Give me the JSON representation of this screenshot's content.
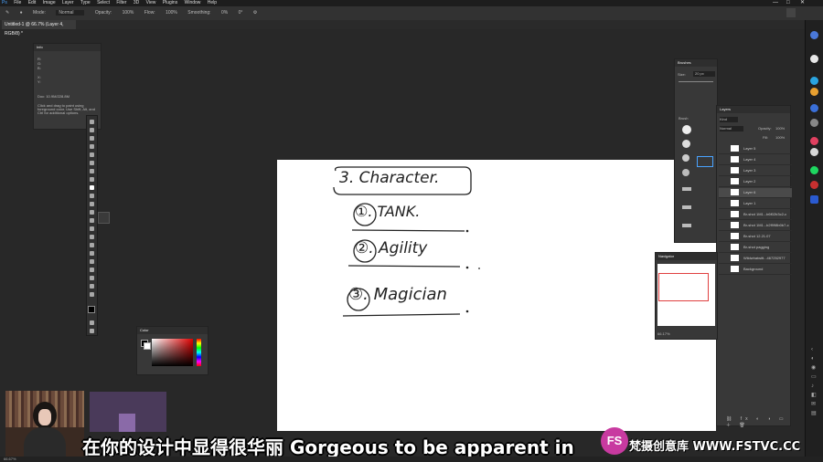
{
  "menu": {
    "items": [
      "File",
      "Edit",
      "Image",
      "Layer",
      "Type",
      "Select",
      "Filter",
      "3D",
      "View",
      "Plugins",
      "Window",
      "Help"
    ]
  },
  "options": {
    "mode_label": "Mode:",
    "mode_value": "Normal",
    "opacity_label": "Opacity:",
    "opacity_value": "100%",
    "flow_label": "Flow:",
    "flow_value": "100%",
    "smoothing_label": "Smoothing:",
    "smoothing_value": "0%",
    "angle_value": "0°"
  },
  "document": {
    "tab_title": "Untitled-1 @ 66.7% (Layer 4, RGB/8) *"
  },
  "info_panel": {
    "title": "Info",
    "r_label": "R:",
    "g_label": "G:",
    "b_label": "B:",
    "x_label": "X:",
    "y_label": "Y:",
    "doc_size": "Doc: 10.9M/228.8M",
    "hint": "Click and drag to paint using foreground color. Use Shift, Alt, and Ctrl for additional options."
  },
  "brushes_panel": {
    "title": "Brushes",
    "size_label": "Size:",
    "size_value": "20 px",
    "folder": "Brush"
  },
  "layers_panel": {
    "title": "Layers",
    "kind_label": "Kind",
    "blend_mode": "Normal",
    "opacity_label": "Opacity:",
    "opacity_value": "100%",
    "fill_label": "Fill:",
    "fill_value": "100%",
    "layers": [
      "Layer 5",
      "Layer 4",
      "Layer 3",
      "Layer 2",
      "Layer 6",
      "Layer 1",
      "Br-shot 1M1...b6f02b3c2-c",
      "Br-shot 1M1...b2f998b0b7-c",
      "Br-shot 12.21.07",
      "Br-shot pagging",
      "Wildwhatwitt...467252977",
      "Background"
    ]
  },
  "navigator_panel": {
    "title": "Navigator",
    "zoom": "66.17%"
  },
  "color_panel": {
    "title": "Color"
  },
  "canvas_text": {
    "heading": "3. Character.",
    "item1": "①. TANK.",
    "item2": "②. Agility",
    "item3": "③. Magician"
  },
  "subtitle": "在你的设计中显得很华丽 Gorgeous to be apparent in",
  "watermark": "梵摄创意库 WWW.FSTVC.CC",
  "watermark_logo": "FS",
  "status": "66.67%",
  "colors": {
    "canvas": "#ffffff",
    "ui_bg": "#282828",
    "panel": "#383838",
    "navigator_box": "#e04040"
  }
}
